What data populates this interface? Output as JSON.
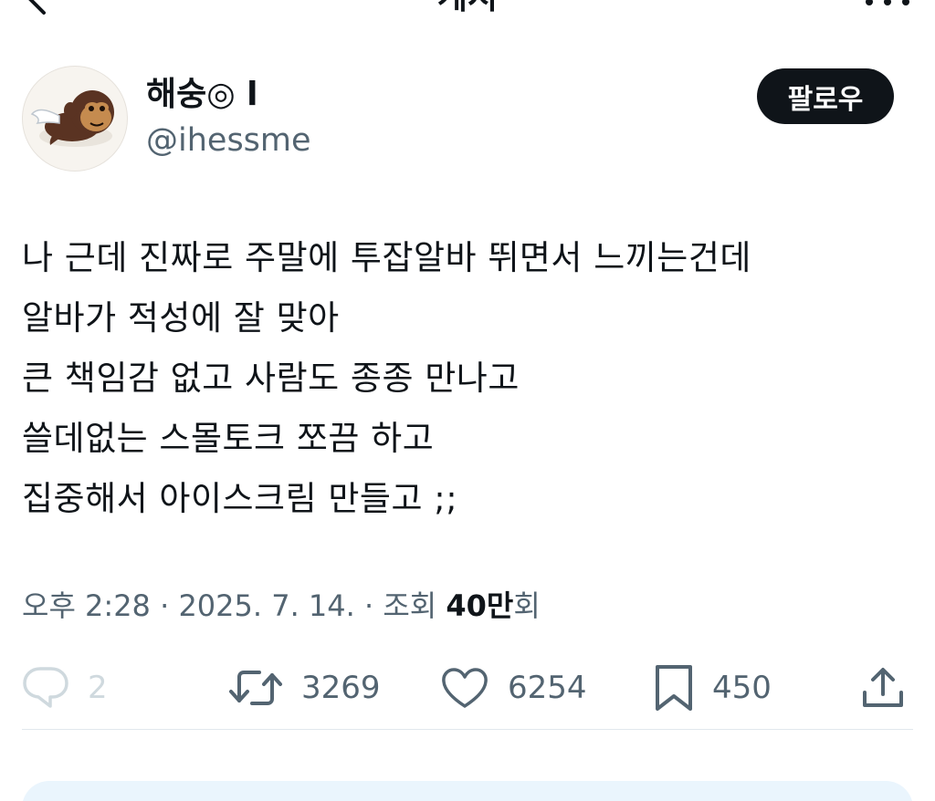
{
  "nav": {
    "title": "게시"
  },
  "author": {
    "display_name": "해숭◎ l",
    "handle": "@ihessme",
    "avatar_icon": "winged-monkey-avatar"
  },
  "follow_button": {
    "label": "팔로우"
  },
  "tweet": {
    "lines": [
      "나 근데 진짜로 주말에 투잡알바 뛰면서 느끼는건데",
      "알바가 적성에 잘 맞아",
      "큰 책임감 없고 사람도 종종 만나고",
      "쓸데없는 스몰토크 쪼끔 하고",
      "집중해서 아이스크림 만들고 ;;"
    ]
  },
  "meta": {
    "time": "오후 2:28",
    "sep1": " · ",
    "date": "2025. 7. 14.",
    "sep2": " · ",
    "views_label": "조회 ",
    "views_number": "40만",
    "views_suffix": "회"
  },
  "actions": {
    "reply_count": "2",
    "retweet_count": "3269",
    "like_count": "6254",
    "bookmark_count": "450"
  },
  "colors": {
    "text": "#0f1419",
    "secondary": "#536471",
    "disabled": "#cfd9de",
    "follow_bg": "#0f1419"
  }
}
